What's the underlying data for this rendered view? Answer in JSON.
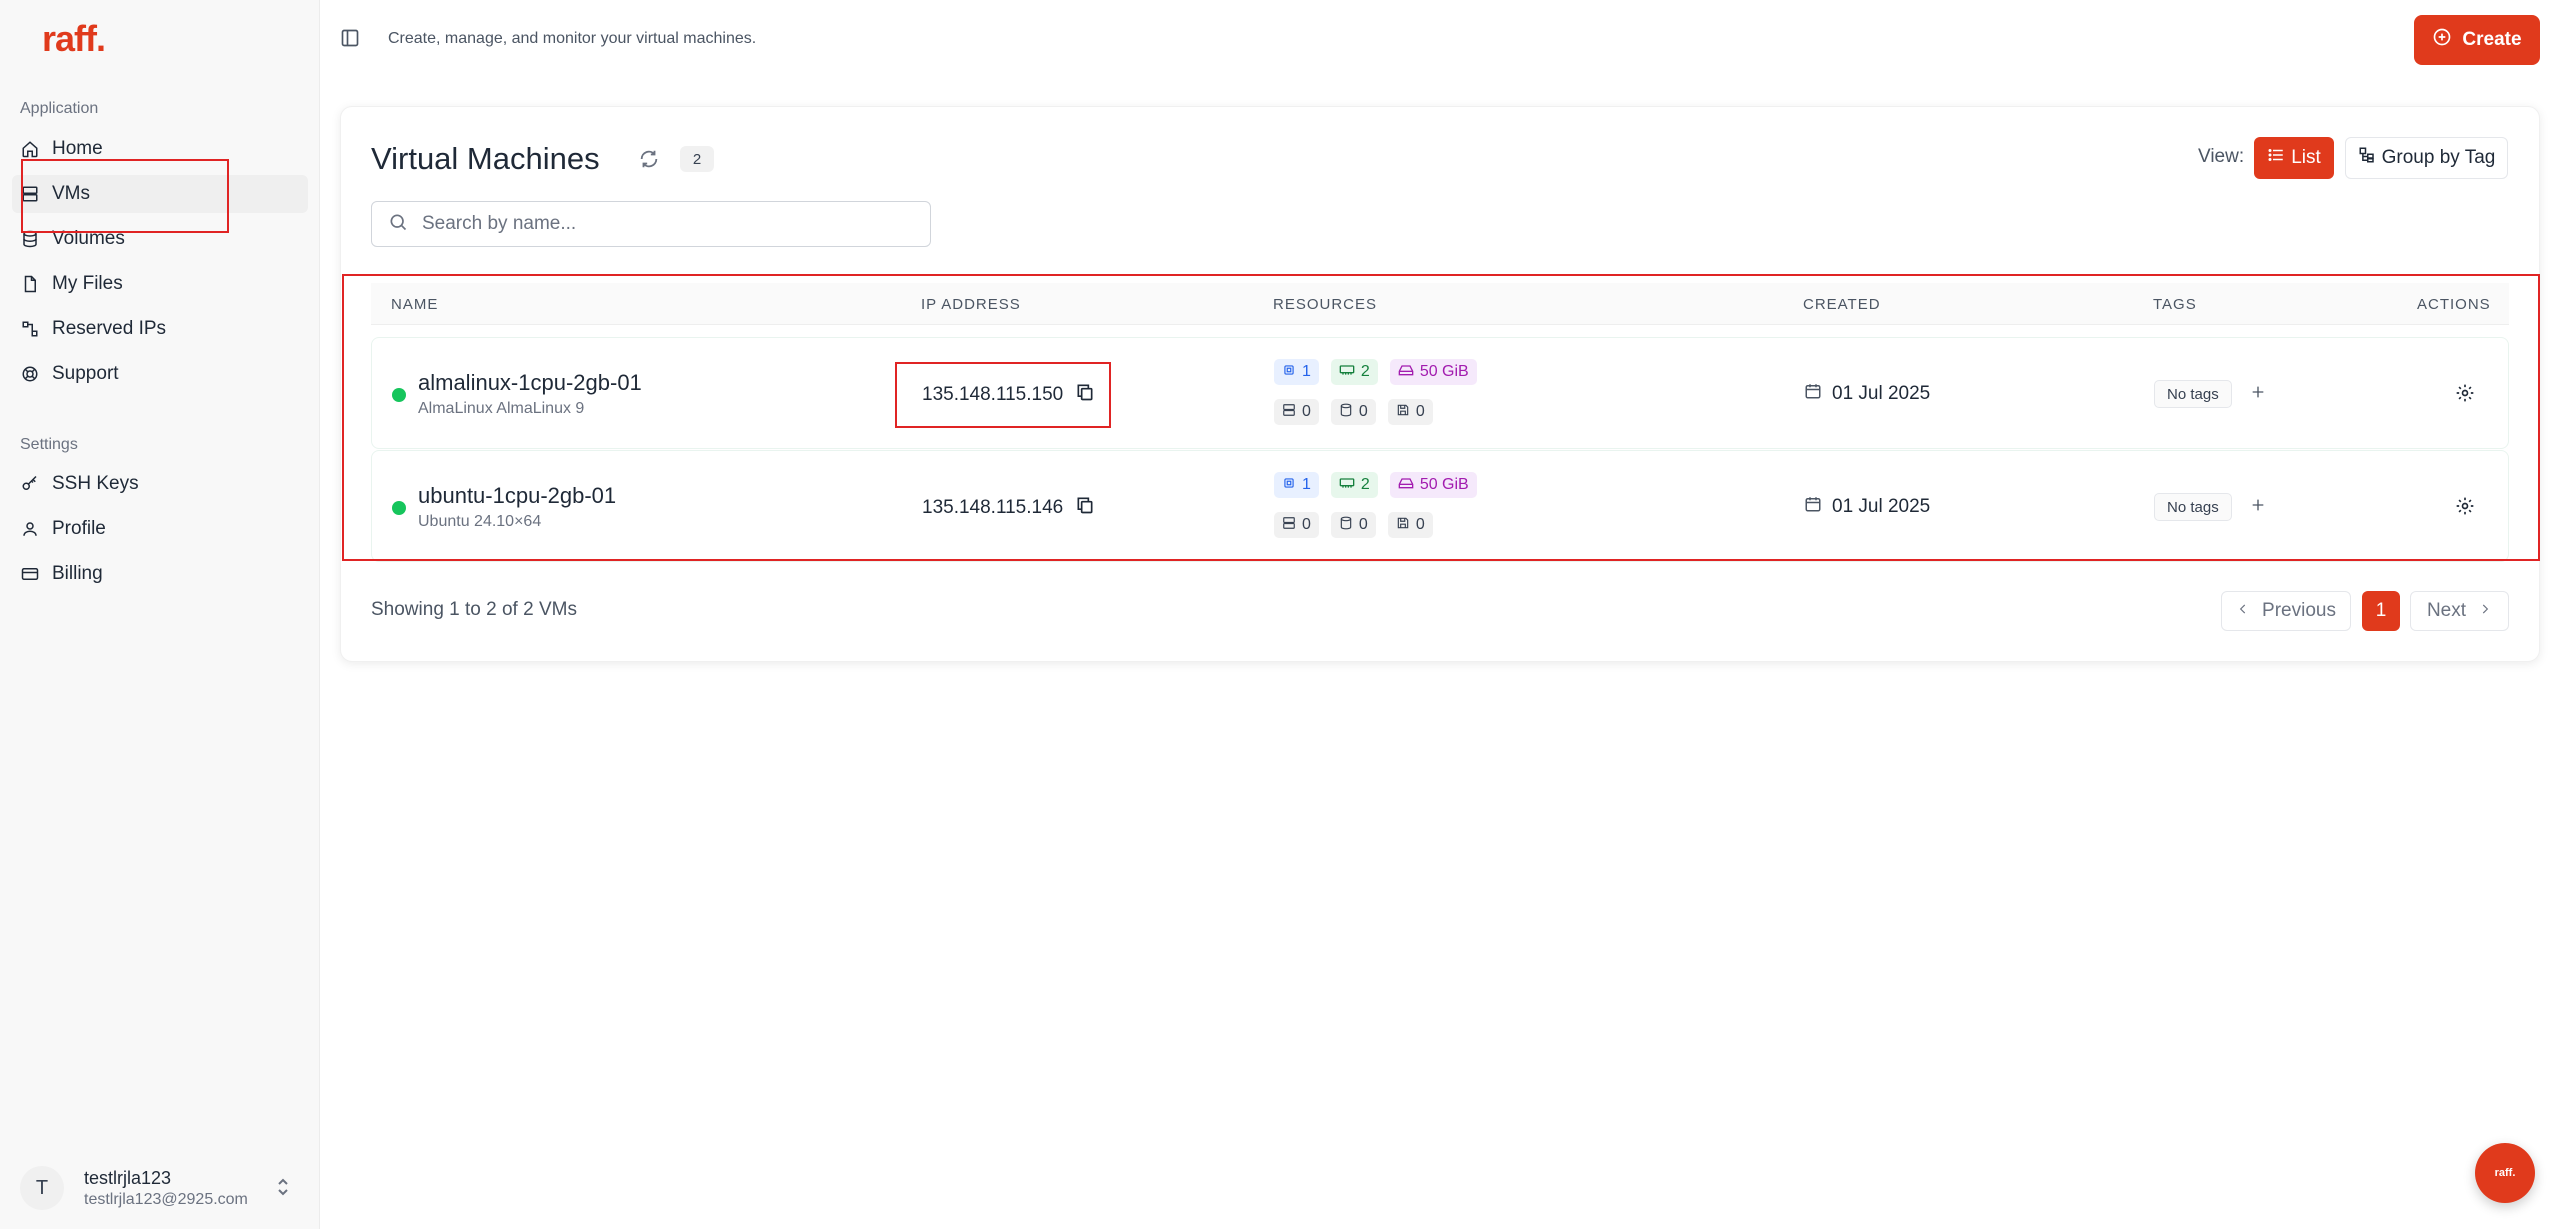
{
  "brand": {
    "logo": "raff.",
    "accent": "#e03a1c"
  },
  "sidebar": {
    "sections": [
      {
        "label": "Application"
      },
      {
        "label": "Settings"
      }
    ],
    "items": [
      {
        "label": "Home",
        "icon": "home-icon"
      },
      {
        "label": "VMs",
        "icon": "server-icon",
        "active": true
      },
      {
        "label": "Volumes",
        "icon": "database-icon"
      },
      {
        "label": "My Files",
        "icon": "file-icon"
      },
      {
        "label": "Reserved IPs",
        "icon": "network-icon"
      },
      {
        "label": "Support",
        "icon": "lifebuoy-icon"
      },
      {
        "label": "SSH Keys",
        "icon": "key-icon"
      },
      {
        "label": "Profile",
        "icon": "user-icon"
      },
      {
        "label": "Billing",
        "icon": "credit-card-icon"
      }
    ],
    "user": {
      "initial": "T",
      "name": "testlrjla123",
      "email": "testlrjla123@2925.com"
    }
  },
  "header": {
    "subtitle": "Create, manage, and monitor your virtual machines.",
    "create_label": "Create"
  },
  "main": {
    "title": "Virtual Machines",
    "count": "2",
    "view_label": "View:",
    "view_list": "List",
    "view_group": "Group by Tag",
    "search_placeholder": "Search by name...",
    "columns": [
      "NAME",
      "IP ADDRESS",
      "RESOURCES",
      "CREATED",
      "TAGS",
      "ACTIONS"
    ],
    "rows": [
      {
        "name": "almalinux-1cpu-2gb-01",
        "os": "AlmaLinux AlmaLinux 9",
        "ip": "135.148.115.150",
        "cpu": "1",
        "ram": "2",
        "disk": "50 GiB",
        "r1": "0",
        "r2": "0",
        "r3": "0",
        "created": "01 Jul 2025",
        "tags": "No tags"
      },
      {
        "name": "ubuntu-1cpu-2gb-01",
        "os": "Ubuntu 24.10×64",
        "ip": "135.148.115.146",
        "cpu": "1",
        "ram": "2",
        "disk": "50 GiB",
        "r1": "0",
        "r2": "0",
        "r3": "0",
        "created": "01 Jul 2025",
        "tags": "No tags"
      }
    ],
    "footer": {
      "showing": "Showing 1 to 2 of 2 VMs",
      "prev": "Previous",
      "page": "1",
      "next": "Next"
    }
  },
  "fab_label": "raff."
}
